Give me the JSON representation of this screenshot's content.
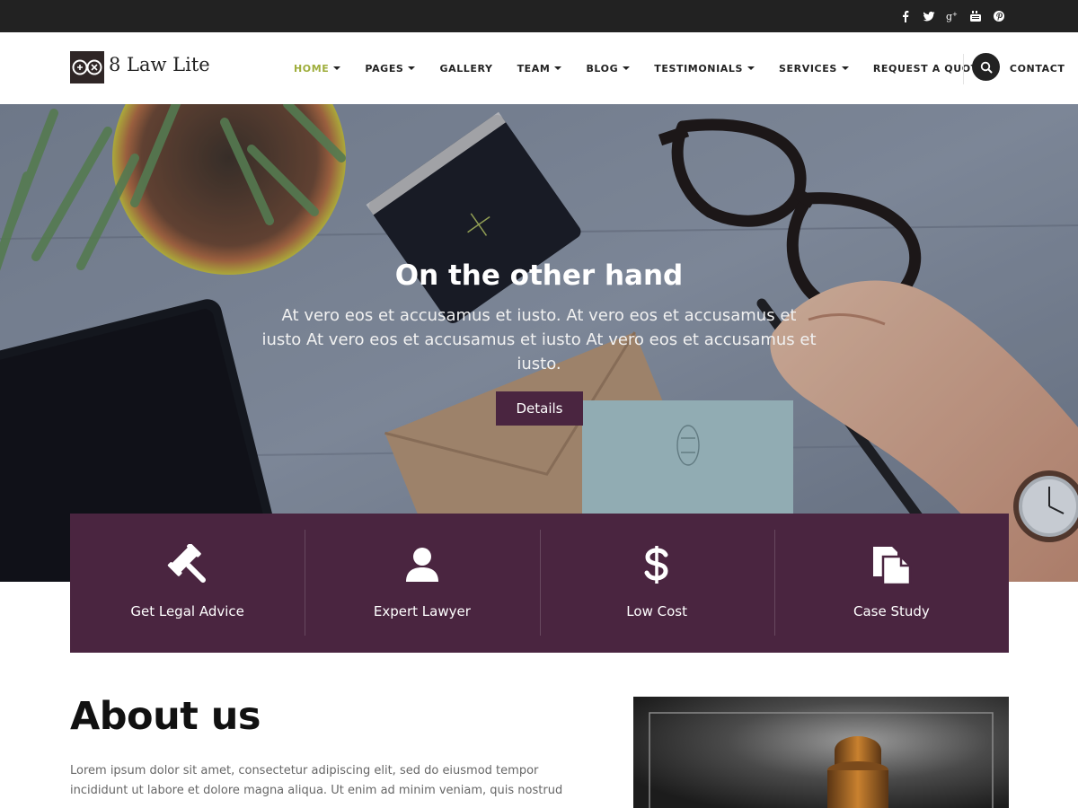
{
  "social": {
    "icons": [
      "facebook-icon",
      "twitter-icon",
      "google-plus-icon",
      "youtube-icon",
      "pinterest-icon"
    ]
  },
  "header": {
    "logo_text": "8 Law Lite",
    "nav": [
      {
        "label": "HOME",
        "has_dropdown": true,
        "active": true
      },
      {
        "label": "PAGES",
        "has_dropdown": true
      },
      {
        "label": "GALLERY",
        "has_dropdown": false
      },
      {
        "label": "TEAM",
        "has_dropdown": true
      },
      {
        "label": "BLOG",
        "has_dropdown": true
      },
      {
        "label": "TESTIMONIALS",
        "has_dropdown": true
      },
      {
        "label": "SERVICES",
        "has_dropdown": true
      },
      {
        "label": "REQUEST A QUOTE",
        "has_dropdown": false
      },
      {
        "label": "CONTACT",
        "has_dropdown": false
      }
    ]
  },
  "hero": {
    "title": "On the other hand",
    "text": "At vero eos et accusamus et iusto. At vero eos et accusamus et iusto At vero eos et accusamus et iusto At vero eos et accusamus et iusto.",
    "button": "Details"
  },
  "features": [
    {
      "label": "Get Legal Advice",
      "icon": "gavel-icon"
    },
    {
      "label": "Expert Lawyer",
      "icon": "user-icon"
    },
    {
      "label": "Low Cost",
      "icon": "dollar-icon"
    },
    {
      "label": "Case Study",
      "icon": "document-icon"
    }
  ],
  "about": {
    "title": "About us",
    "text": "Lorem ipsum dolor sit amet, consectetur adipiscing elit, sed do eiusmod tempor incididunt ut labore et dolore magna aliqua. Ut enim ad minim veniam, quis nostrud"
  },
  "colors": {
    "accent": "#4a2540",
    "active_nav": "#9fae3c",
    "topbar": "#222222"
  }
}
